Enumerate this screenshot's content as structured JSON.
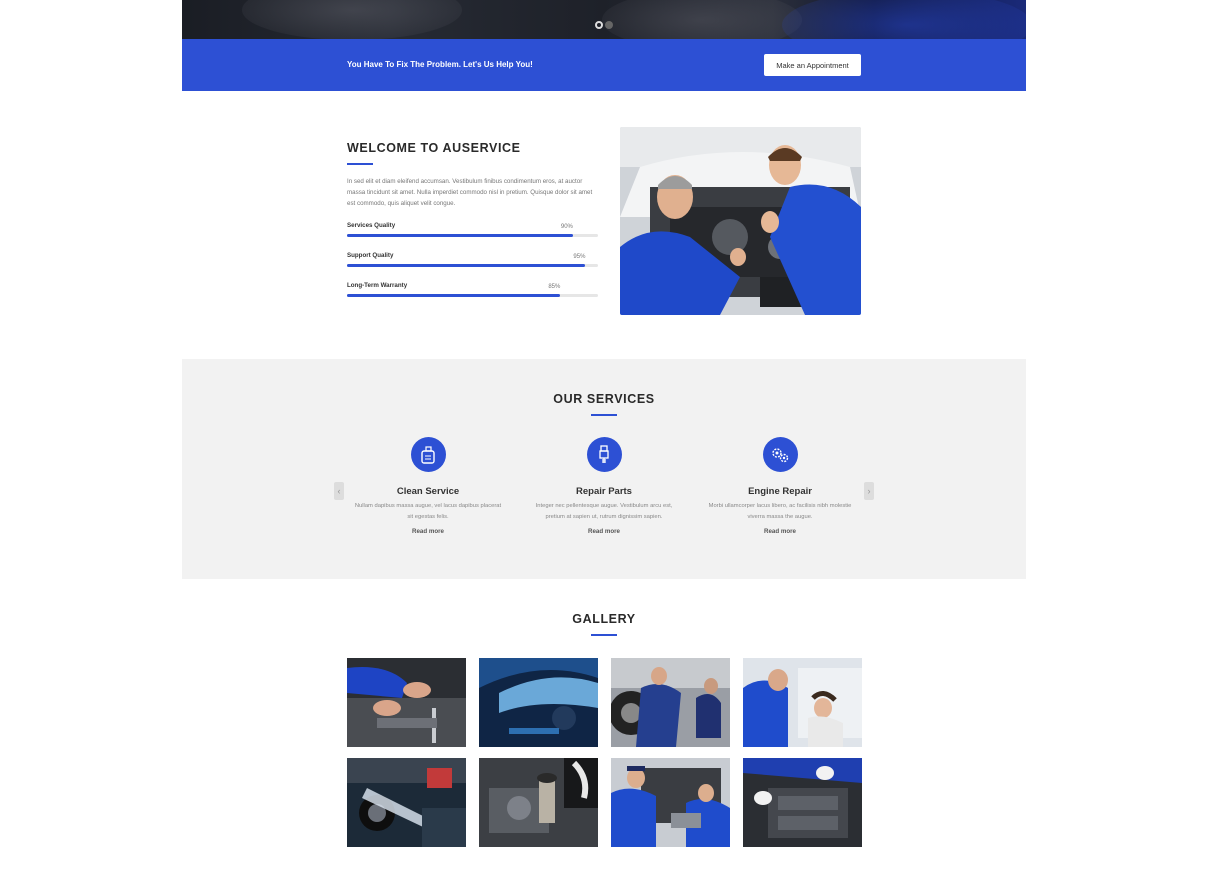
{
  "hero": {
    "slides": 2,
    "active_slide": 1
  },
  "cta": {
    "text": "You Have To Fix The Problem. Let's Us Help You!",
    "button_label": "Make an Appointment"
  },
  "welcome": {
    "title": "WELCOME TO AUSERVICE",
    "text": "In sed elit et diam eleifend accumsan. Vestibulum finibus condimentum eros, at auctor massa tincidunt sit amet. Nulla imperdiet commodo nisl in pretium. Quisque dolor sit amet est commodo, quis aliquet velit congue.",
    "skills": [
      {
        "label": "Services Quality",
        "percent_text": "90%",
        "value": 90
      },
      {
        "label": "Support Quality",
        "percent_text": "95%",
        "value": 95
      },
      {
        "label": "Long-Term Warranty",
        "percent_text": "85%",
        "value": 85
      }
    ]
  },
  "services": {
    "title": "OUR SERVICES",
    "items": [
      {
        "icon": "oil-bottle-icon",
        "name": "Clean Service",
        "desc": "Nullam dapibus massa augue, vel lacus dapibus placerat sit egestas felis.",
        "link": "Read more"
      },
      {
        "icon": "spark-plug-icon",
        "name": "Repair Parts",
        "desc": "Integer nec pellentesque augue. Vestibulum arcu est, pretium at sapien ut, rutrum dignissim sapien.",
        "link": "Read more"
      },
      {
        "icon": "gears-icon",
        "name": "Engine Repair",
        "desc": "Morbi ullamcorper lacus libero, ac facilisis nibh molestie viverra massa the augue.",
        "link": "Read more"
      }
    ],
    "prev_icon": "chevron-left-icon",
    "next_icon": "chevron-right-icon"
  },
  "gallery": {
    "title": "GALLERY",
    "items": [
      "hands-with-wrench",
      "car-dashboard",
      "mechanic-at-tire",
      "mechanic-and-driver",
      "pressure-washing-car",
      "engine-closeup",
      "mechanics-thumbs-up",
      "engine-inspection"
    ]
  },
  "colors": {
    "accent": "#2d50d4",
    "light_gray": "#f2f2f2",
    "dark": "#2a2a2a"
  }
}
